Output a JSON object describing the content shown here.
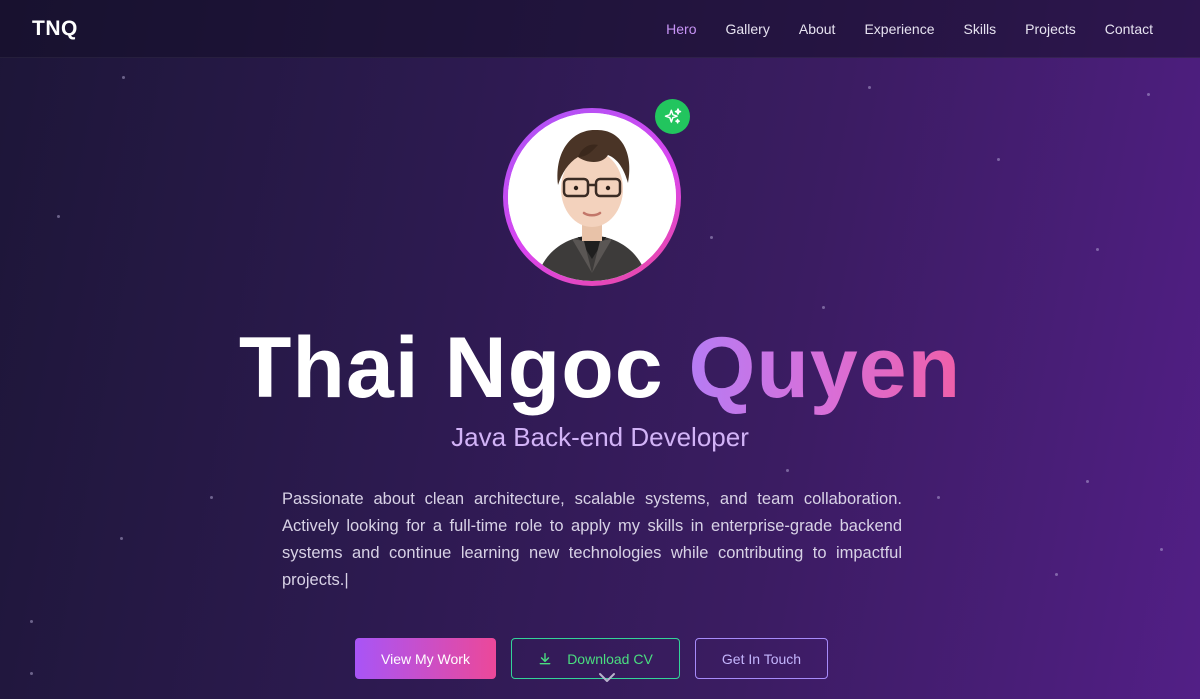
{
  "nav": {
    "logo": "TNQ",
    "links": [
      "Hero",
      "Gallery",
      "About",
      "Experience",
      "Skills",
      "Projects",
      "Contact"
    ],
    "active": "Hero"
  },
  "hero": {
    "first_name": "Thai Ngoc",
    "last_name": "Quyen",
    "role": "Java Back-end Developer",
    "description": "Passionate about clean architecture, scalable systems, and team collaboration. Actively looking for a full-time role to apply my skills in enterprise-grade backend systems and continue learning new technologies while contributing to impactful projects.",
    "cursor": "|"
  },
  "buttons": {
    "view_work": "View My Work",
    "download_cv": "Download CV",
    "get_in_touch": "Get In Touch"
  },
  "icons": {
    "badge": "sparkles-icon",
    "download": "download-icon",
    "scroll": "chevron-down-icon"
  },
  "colors": {
    "accent_purple": "#a855f7",
    "accent_pink": "#ec4899",
    "badge_green": "#22c55e",
    "active_link": "#c794f5"
  }
}
